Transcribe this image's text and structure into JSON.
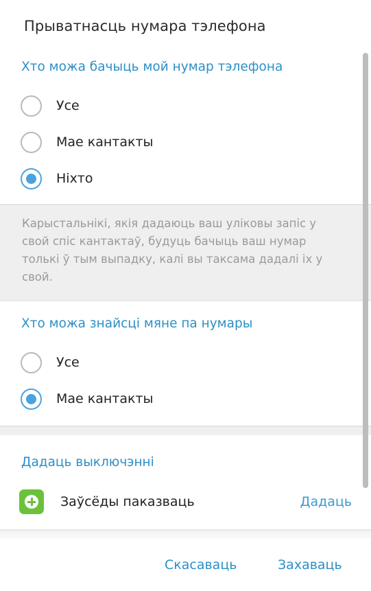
{
  "dialog": {
    "title": "Прыватнасць нумара тэлефона"
  },
  "who_sees": {
    "title": "Хто можа бачыць мой нумар тэлефона",
    "options": [
      {
        "label": "Усе",
        "checked": false
      },
      {
        "label": "Мае кантакты",
        "checked": false
      },
      {
        "label": "Ніхто",
        "checked": true
      }
    ],
    "info": "Карыстальнікі, якія дадаюць ваш уліковы запіс у свой спіс кантактаў, будуць бачыць ваш нумар толькі ў тым выпадку, калі вы таксама дадалі іх у свой."
  },
  "who_finds": {
    "title": "Хто можа знайсці мяне па нумары",
    "options": [
      {
        "label": "Усе",
        "checked": false
      },
      {
        "label": "Мае кантакты",
        "checked": true
      }
    ]
  },
  "exceptions": {
    "title": "Дадаць выключэнні",
    "always_show_label": "Заўсёды паказваць",
    "add_label": "Дадаць",
    "icon": "plus-circle-icon",
    "icon_color": "#6cc13b"
  },
  "footer": {
    "cancel_label": "Скасаваць",
    "save_label": "Захаваць"
  },
  "colors": {
    "accent": "#2c8fc6",
    "radio_checked": "#4aa3df",
    "radio_unchecked": "#b9b9b9"
  }
}
